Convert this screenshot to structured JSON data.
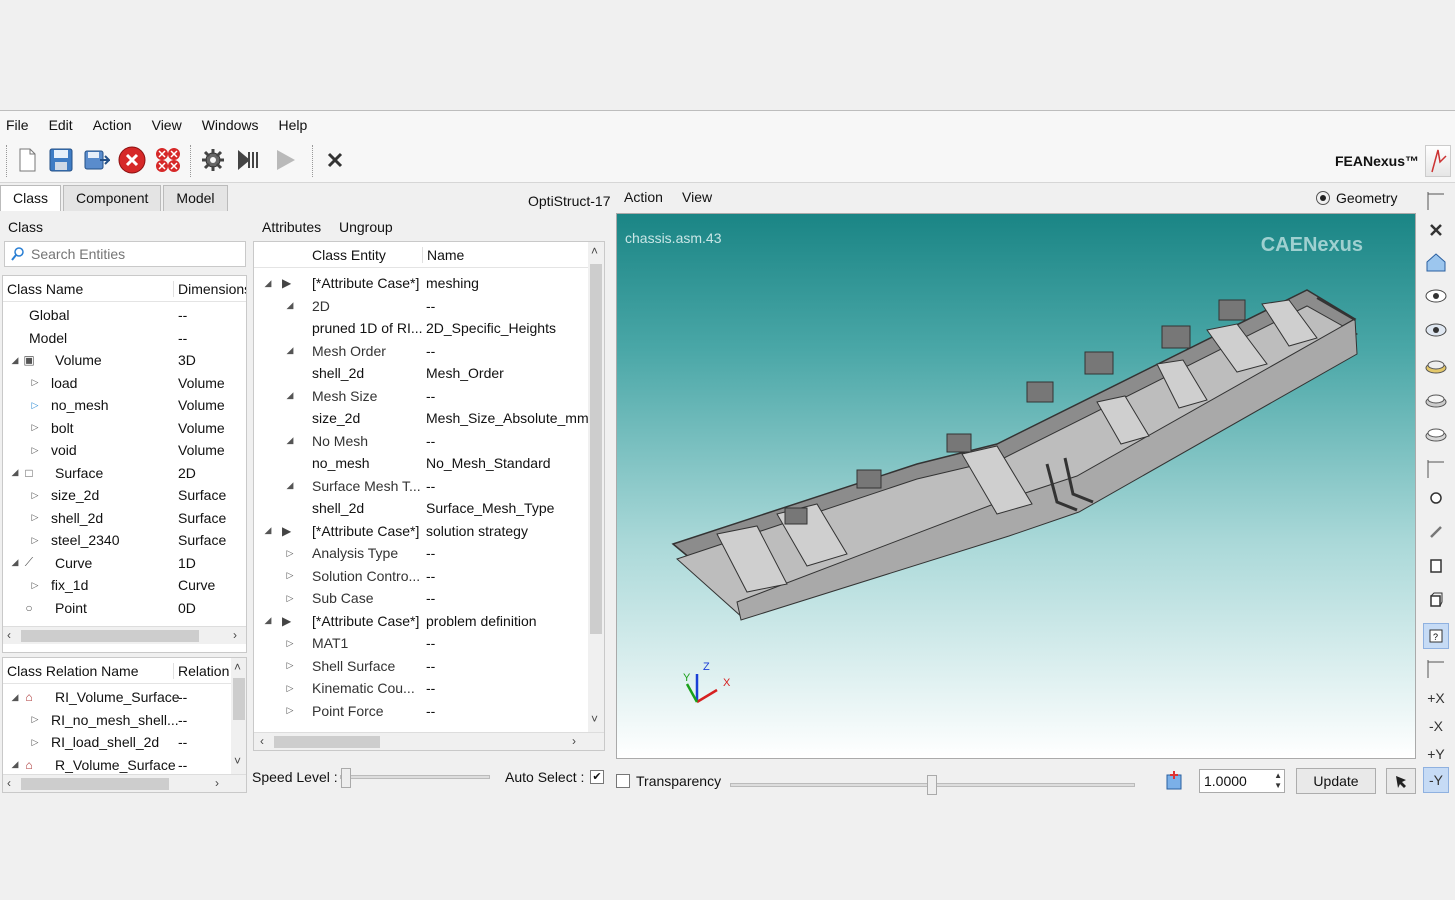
{
  "menu": [
    "File",
    "Edit",
    "Action",
    "View",
    "Windows",
    "Help"
  ],
  "brand": "FEANexus™",
  "tabs": {
    "class": "Class",
    "component": "Component",
    "model": "Model"
  },
  "solver": "OptiStruct-17",
  "class_panel": {
    "title": "Class",
    "search_placeholder": "Search Entities",
    "col_name": "Class Name",
    "col_dim": "Dimensions",
    "rows": [
      {
        "name": "Global",
        "dim": "--"
      },
      {
        "name": "Model",
        "dim": "--"
      },
      {
        "name": "Volume",
        "dim": "3D"
      },
      {
        "name": "load",
        "dim": "Volume"
      },
      {
        "name": "no_mesh",
        "dim": "Volume"
      },
      {
        "name": "bolt",
        "dim": "Volume"
      },
      {
        "name": "void",
        "dim": "Volume"
      },
      {
        "name": "Surface",
        "dim": "2D"
      },
      {
        "name": "size_2d",
        "dim": "Surface"
      },
      {
        "name": "shell_2d",
        "dim": "Surface"
      },
      {
        "name": "steel_2340",
        "dim": "Surface"
      },
      {
        "name": "Curve",
        "dim": "1D"
      },
      {
        "name": "fix_1d",
        "dim": "Curve"
      },
      {
        "name": "Point",
        "dim": "0D"
      }
    ]
  },
  "relation_panel": {
    "col_name": "Class Relation Name",
    "col_rel": "Relation",
    "rows": [
      {
        "name": "RI_Volume_Surface",
        "rel": "--"
      },
      {
        "name": "RI_no_mesh_shell...",
        "rel": "--"
      },
      {
        "name": "RI_load_shell_2d",
        "rel": "--"
      },
      {
        "name": "R_Volume_Surface",
        "rel": "--"
      }
    ]
  },
  "attr_panel": {
    "tab_attributes": "Attributes",
    "tab_ungroup": "Ungroup",
    "col_entity": "Class Entity",
    "col_name": "Name",
    "rows": [
      {
        "entity": "[*Attribute Case*]",
        "name": "meshing"
      },
      {
        "entity": "2D",
        "name": "--"
      },
      {
        "entity": "pruned 1D of RI...",
        "name": "2D_Specific_Heights"
      },
      {
        "entity": "Mesh Order",
        "name": "--"
      },
      {
        "entity": "shell_2d",
        "name": "Mesh_Order"
      },
      {
        "entity": "Mesh Size",
        "name": "--"
      },
      {
        "entity": "size_2d",
        "name": "Mesh_Size_Absolute_mm"
      },
      {
        "entity": "No Mesh",
        "name": "--"
      },
      {
        "entity": "no_mesh",
        "name": "No_Mesh_Standard"
      },
      {
        "entity": "Surface Mesh T...",
        "name": "--"
      },
      {
        "entity": "shell_2d",
        "name": "Surface_Mesh_Type"
      },
      {
        "entity": "[*Attribute Case*]",
        "name": "solution strategy"
      },
      {
        "entity": "Analysis Type",
        "name": "--"
      },
      {
        "entity": "Solution Contro...",
        "name": "--"
      },
      {
        "entity": "Sub Case",
        "name": "--"
      },
      {
        "entity": "[*Attribute Case*]",
        "name": "problem definition"
      },
      {
        "entity": "MAT1",
        "name": "--"
      },
      {
        "entity": "Shell Surface",
        "name": "--"
      },
      {
        "entity": "Kinematic Cou...",
        "name": "--"
      },
      {
        "entity": "Point Force",
        "name": "--"
      }
    ],
    "speed_label": "Speed Level :",
    "auto_select_label": "Auto Select :"
  },
  "viewer": {
    "menu_action": "Action",
    "menu_view": "View",
    "geometry_label": "Geometry",
    "model_name": "chassis.asm.43",
    "watermark": "CAENexus",
    "axis_x": "X",
    "axis_y": "Y",
    "axis_z": "Z",
    "transparency_label": "Transparency",
    "scale_value": "1.0000",
    "update_label": "Update",
    "view_px": "+X",
    "view_nx": "-X",
    "view_py": "+Y",
    "view_ny": "-Y"
  }
}
